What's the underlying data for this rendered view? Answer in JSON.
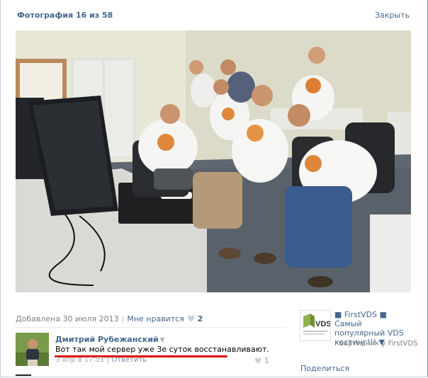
{
  "header": {
    "title": "Фотография 16 из 58",
    "close_label": "Закрыть"
  },
  "photo": {
    "alt": "photo"
  },
  "info": {
    "date_label": "Добавлена 30 июля 2013",
    "like_label": "Мне нравится",
    "like_count": "2"
  },
  "comment": {
    "author": "Дмитрий Рубежанский",
    "text": "Вот так мой сервер уже 3е суток восстанавливают.",
    "time": "3 апр в 17:51",
    "reply_label": "Ответить",
    "like_count": "1"
  },
  "ad": {
    "title": "■ FirstVDS ■ Самый популярный VDS хостинг!!! ▼",
    "domain": "Квартирник у FirstVDS"
  },
  "share_label": "Поделиться",
  "colors": {
    "link": "#45688e",
    "muted": "#7b8085",
    "underline": "#e20000",
    "heart": "#c7d1dc"
  },
  "icons": {
    "heart": "heart-icon",
    "author_menu": "chevron-down-icon"
  }
}
